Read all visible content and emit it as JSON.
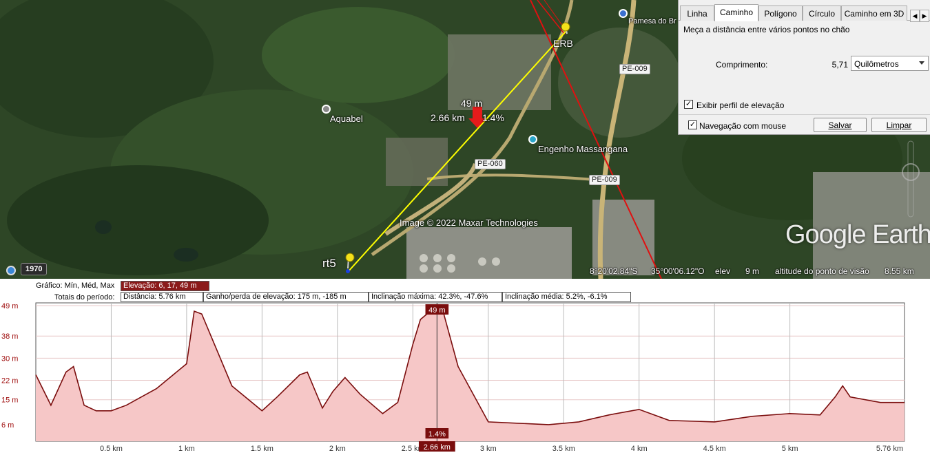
{
  "map": {
    "labels": {
      "erb": "ERB",
      "rt5": "rt5",
      "aquabel": "Aquabel",
      "engenho": "Engenho Massangana",
      "pamesa": "Pamesa do Br",
      "marker_elev": "49 m",
      "marker_dist": "2.66 km",
      "marker_slope": "1.4%",
      "copyright": "Image © 2022 Maxar Technologies"
    },
    "roads": {
      "pe009_top": "PE-009",
      "pe060": "PE-060",
      "pe009_mid": "PE-009"
    },
    "logo": "Google Earth",
    "year": "1970",
    "status": {
      "lat": "8°20'02.84\"S",
      "lon": "35°00'06.12\"O",
      "elev_label": "elev",
      "elev_value": "9 m",
      "eye_label": "altitude do ponto de visão",
      "eye_value": "8.55 km"
    },
    "colors": {
      "path": "#ffff00",
      "line": "#e01010"
    }
  },
  "ruler": {
    "tabs": [
      "Linha",
      "Caminho",
      "Polígono",
      "Círculo",
      "Caminho em 3D"
    ],
    "active_tab": "Caminho",
    "description": "Meça a distância entre vários pontos no chão",
    "length_label": "Comprimento:",
    "length_value": "5,71",
    "unit": "Quilômetros",
    "show_elevation_label": "Exibir perfil de elevação",
    "show_elevation_checked": "✓",
    "mouse_nav_label": "Navegação com mouse",
    "mouse_nav_checked": "✓",
    "save": "Salvar",
    "clear": "Limpar"
  },
  "profile": {
    "graph_label": "Gráfico: Mín, Méd, Max",
    "elevation_stat": "Elevação: 6, 17, 49 m",
    "totals_label": "Totais do período:",
    "distance_stat": "Distância: 5.76 km",
    "gain_stat": "Ganho/perda de elevação: 175 m, -185 m",
    "max_slope_stat": "Inclinação máxima: 42.3%, -47.6%",
    "avg_slope_stat": "Inclinação média: 5.2%, -6.1%",
    "cursor_elev": "49 m",
    "cursor_slope": "1.4%",
    "cursor_dist": "2.66 km",
    "y_ticks": [
      "49 m",
      "38 m",
      "30 m",
      "22 m",
      "15 m",
      "6 m"
    ],
    "x_ticks": [
      "0.5 km",
      "1 km",
      "1.5 km",
      "2 km",
      "2.5 km",
      "3 km",
      "3.5 km",
      "4 km",
      "4.5 km",
      "5 km",
      "5.76 km"
    ],
    "line_color": "#7a0d0d",
    "fill_color": "#f6c7c7"
  },
  "chart_data": {
    "type": "area",
    "xlabel": "",
    "ylabel": "",
    "xlim": [
      0,
      5.76
    ],
    "ylim": [
      0,
      50
    ],
    "x": [
      0,
      0.1,
      0.2,
      0.25,
      0.32,
      0.4,
      0.5,
      0.6,
      0.8,
      1.0,
      1.05,
      1.1,
      1.2,
      1.3,
      1.5,
      1.6,
      1.75,
      1.8,
      1.9,
      1.97,
      2.05,
      2.15,
      2.3,
      2.4,
      2.5,
      2.55,
      2.66,
      2.7,
      2.8,
      2.92,
      3.0,
      3.2,
      3.4,
      3.6,
      3.8,
      4.0,
      4.2,
      4.5,
      4.75,
      5.0,
      5.2,
      5.3,
      5.35,
      5.4,
      5.6,
      5.76
    ],
    "values": [
      24,
      13,
      25,
      27,
      13,
      11,
      11,
      13,
      19,
      28,
      47,
      46,
      33,
      20,
      11,
      16,
      24,
      25,
      12,
      18,
      23,
      17,
      10,
      14,
      35,
      44,
      49,
      47,
      27,
      15,
      7,
      6.5,
      6,
      7,
      9.5,
      11.5,
      7.5,
      7,
      9,
      10,
      9.5,
      16,
      20,
      16,
      14,
      14
    ]
  }
}
